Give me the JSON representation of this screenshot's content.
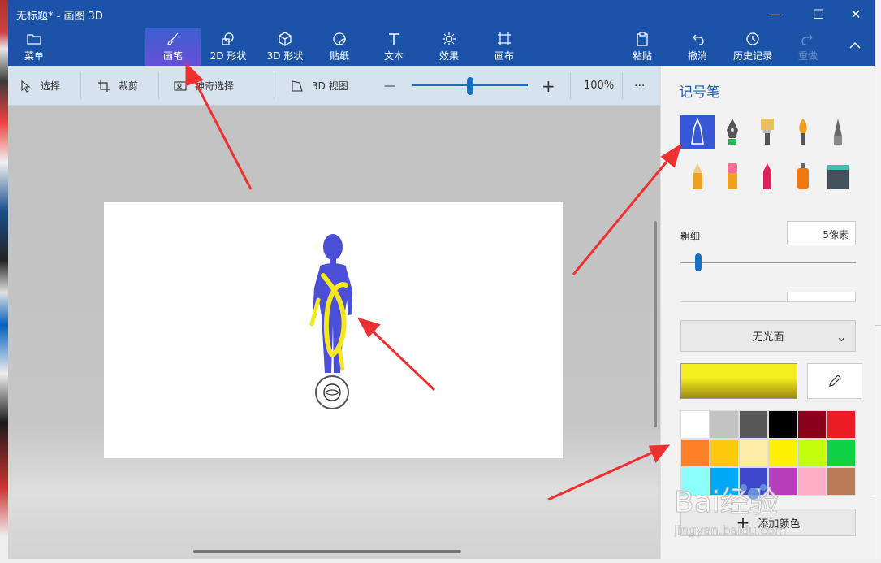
{
  "window": {
    "title": "无标题* - 画图 3D",
    "controls": {
      "minimize": "—",
      "maximize": "☐",
      "close": "✕"
    }
  },
  "toolbar": {
    "menu": "菜单",
    "brushes": "画笔",
    "shapes_2d": "2D 形状",
    "shapes_3d": "3D 形状",
    "stickers": "贴纸",
    "text": "文本",
    "effects": "效果",
    "canvas": "画布",
    "paste": "粘贴",
    "undo": "撤消",
    "history": "历史记录",
    "redo": "重做"
  },
  "subbar": {
    "select": "选择",
    "crop": "裁剪",
    "magic_select": "神奇选择",
    "view_3d": "3D 视图",
    "zoom_minus": "—",
    "zoom_plus": "+",
    "zoom_level": "100%",
    "more": "···"
  },
  "panel": {
    "title": "记号笔",
    "thickness_label": "粗细",
    "thickness_value": "5像素",
    "thickness_level": 0.05,
    "finish_value": "无光面",
    "add_color": "添加颜色",
    "brushes": [
      "marker",
      "calligraphy-pen",
      "oil-brush",
      "watercolor",
      "pixel-pen",
      "pencil",
      "eraser",
      "crayon",
      "spray-can",
      "fill-bucket"
    ],
    "selected_color": "#f5ef1f",
    "palette": [
      "#ffffff",
      "#c3c3c3",
      "#585858",
      "#000000",
      "#88001b",
      "#ec1c24",
      "#ff7f27",
      "#ffc90e",
      "#fdeca6",
      "#fff200",
      "#c4ff0e",
      "#0ed145",
      "#8cfffb",
      "#00a8f3",
      "#3f48cc",
      "#b83dba",
      "#ffaec8",
      "#b97a56"
    ]
  },
  "watermark": {
    "brand": "Bai经验",
    "url": "jingyan.baidu.com"
  },
  "accent": "#1a53a8"
}
